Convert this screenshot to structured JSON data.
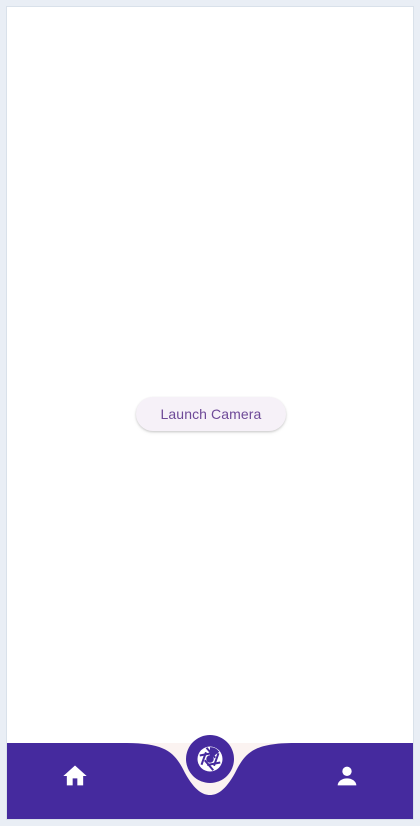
{
  "main": {
    "launch_button_label": "Launch Camera"
  },
  "bottom_nav": {
    "items": [
      {
        "icon": "home-icon"
      },
      {
        "icon": "camera-shutter-icon"
      },
      {
        "icon": "person-icon"
      }
    ]
  },
  "colors": {
    "nav_background": "#452a9e",
    "notch_background": "#fbf3f1",
    "button_background": "#f6f1f8",
    "button_text": "#6e4a98",
    "page_background": "#ffffff"
  }
}
